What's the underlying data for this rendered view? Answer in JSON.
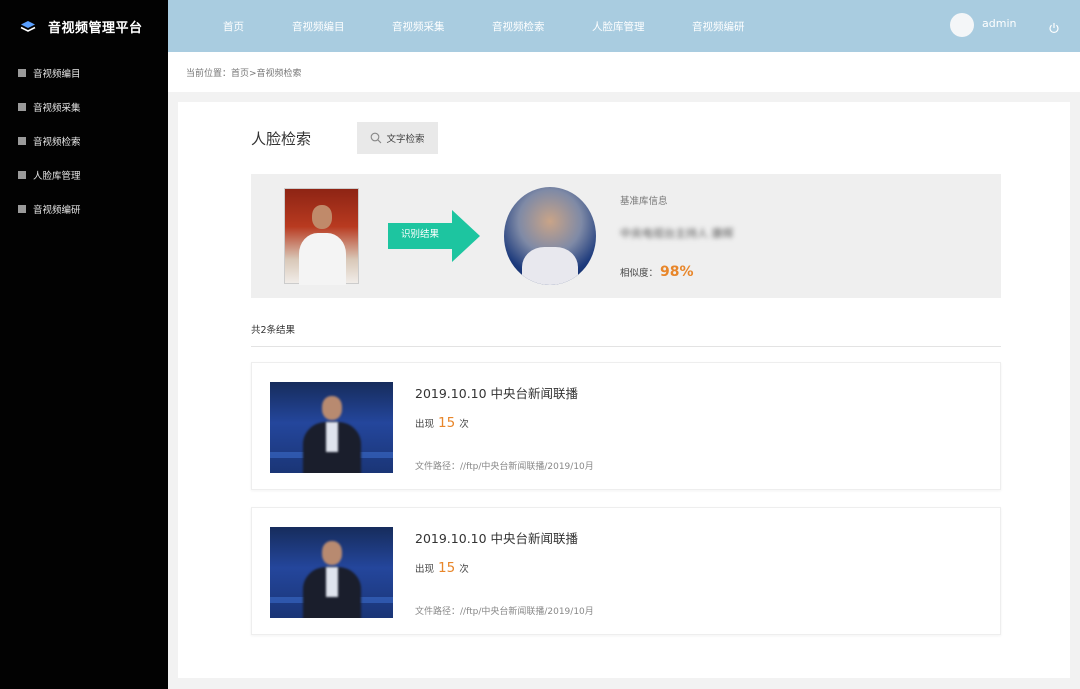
{
  "app": {
    "title": "音视频管理平台",
    "brand_icon": "layers-icon"
  },
  "topnav": {
    "items": [
      {
        "label": "首页"
      },
      {
        "label": "音视频编目"
      },
      {
        "label": "音视频采集"
      },
      {
        "label": "音视频检索"
      },
      {
        "label": "人脸库管理"
      },
      {
        "label": "音视频编研"
      }
    ],
    "username": "admin",
    "power_icon": "power-icon",
    "background_color": "#a9cce0"
  },
  "sidebar": {
    "items": [
      {
        "label": "音视频编目"
      },
      {
        "label": "音视频采集"
      },
      {
        "label": "音视频检索"
      },
      {
        "label": "人脸库管理"
      },
      {
        "label": "音视频编研"
      }
    ]
  },
  "breadcrumb": "当前位置：首页>音视频检索",
  "page": {
    "title": "人脸检索",
    "text_search_label": "文字检索",
    "text_search_icon": "search-icon"
  },
  "recognition": {
    "arrow_label": "识别结果",
    "info_label": "基准库信息",
    "info_name": "中央电视台主持人 康辉",
    "similarity_label": "相似度：",
    "similarity_value": "98%",
    "accent_color": "#1dc5a0",
    "highlight_color": "#e8862a"
  },
  "results": {
    "count_text": "共2条结果",
    "items": [
      {
        "title": "2019.10.10 中央台新闻联播",
        "count_prefix": "出现",
        "count": "15",
        "count_suffix": "次",
        "path": "文件路径：//ftp/中央台新闻联播/2019/10月"
      },
      {
        "title": "2019.10.10 中央台新闻联播",
        "count_prefix": "出现",
        "count": "15",
        "count_suffix": "次",
        "path": "文件路径：//ftp/中央台新闻联播/2019/10月"
      }
    ]
  }
}
